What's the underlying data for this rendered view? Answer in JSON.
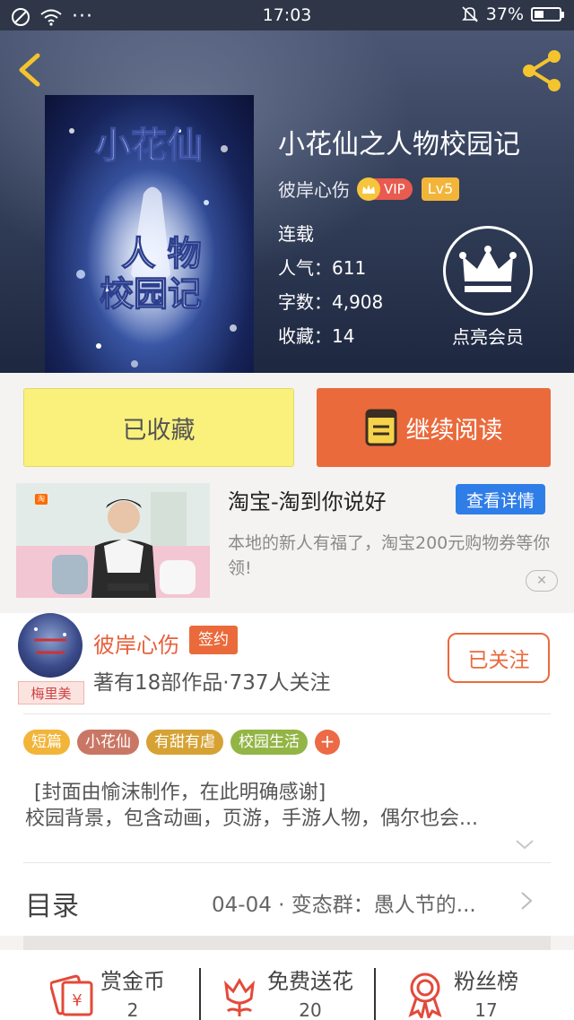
{
  "status_bar": {
    "time": "17:03",
    "battery_percent": "37%",
    "battery_level": 0.37,
    "dots": "···"
  },
  "header": {
    "back_icon": "chevron-left-icon",
    "share_icon": "share-icon"
  },
  "book": {
    "cover_text_top": "小花仙",
    "cover_text_bottom_1": "人 物",
    "cover_text_bottom_2": "校园记",
    "title": "小花仙之人物校园记",
    "author": "彼岸心伤",
    "vip_label": "VIP",
    "level": "Lv5",
    "status": "连载",
    "popularity": "人气：611",
    "word_count": "字数：4,908",
    "favorites": "收藏：14",
    "member_label": "点亮会员"
  },
  "actions": {
    "favorited_label": "已收藏",
    "continue_label": "继续阅读"
  },
  "ad": {
    "tag": "淘",
    "title": "淘宝-淘到你说好",
    "detail_button": "查看详情",
    "description": "本地的新人有福了，淘宝200元购物券等你领!",
    "close_symbol": "✕"
  },
  "author_card": {
    "avatar_tag": "梅里美",
    "name": "彼岸心伤",
    "sign_badge": "签约",
    "stats": "著有18部作品·737人关注",
    "follow_label": "已关注"
  },
  "tags": [
    {
      "label": "短篇",
      "color": "#f2b53a"
    },
    {
      "label": "小花仙",
      "color": "#c97764"
    },
    {
      "label": "有甜有虐",
      "color": "#d6a233"
    },
    {
      "label": "校园生活",
      "color": "#93b546"
    }
  ],
  "tag_add": "+",
  "intro": {
    "line1": "[封面由愉沫制作，在此明确感谢]",
    "line2": "校园背景，包含动画，页游，手游人物，偶尔也会..."
  },
  "catalog": {
    "label": "目录",
    "latest": "04-04 · 变态群：愚人节的..."
  },
  "bottom_stats": [
    {
      "label": "赏金币",
      "value": "2",
      "icon": "red-envelope-icon"
    },
    {
      "label": "免费送花",
      "value": "20",
      "icon": "flower-icon"
    },
    {
      "label": "粉丝榜",
      "value": "17",
      "icon": "medal-icon"
    }
  ],
  "colors": {
    "accent": "#ea6a3c",
    "fav_button": "#f9f17c",
    "ad_button": "#2f7ee8",
    "header_bg": "#2e3648"
  }
}
